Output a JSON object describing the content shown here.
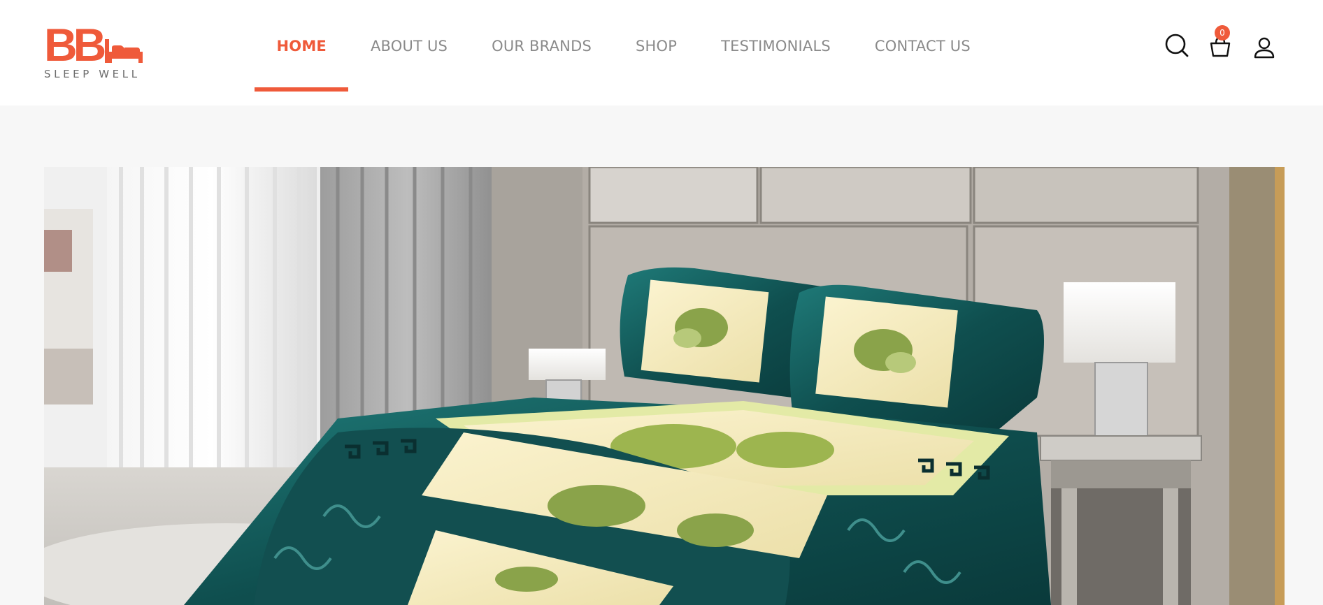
{
  "brand": {
    "logo_text": "BB",
    "tagline": "SLEEP WELL",
    "color": "#ef5a3a"
  },
  "nav": {
    "items": [
      {
        "label": "HOME",
        "active": true
      },
      {
        "label": "ABOUT US",
        "active": false
      },
      {
        "label": "OUR BRANDS",
        "active": false
      },
      {
        "label": "SHOP",
        "active": false
      },
      {
        "label": "TESTIMONIALS",
        "active": false
      },
      {
        "label": "CONTACT US",
        "active": false
      }
    ]
  },
  "header_icons": {
    "search": "search-icon",
    "cart": "basket-icon",
    "account": "user-icon",
    "cart_count": "0"
  },
  "hero": {
    "image": "bedroom-bedspread-photo"
  }
}
